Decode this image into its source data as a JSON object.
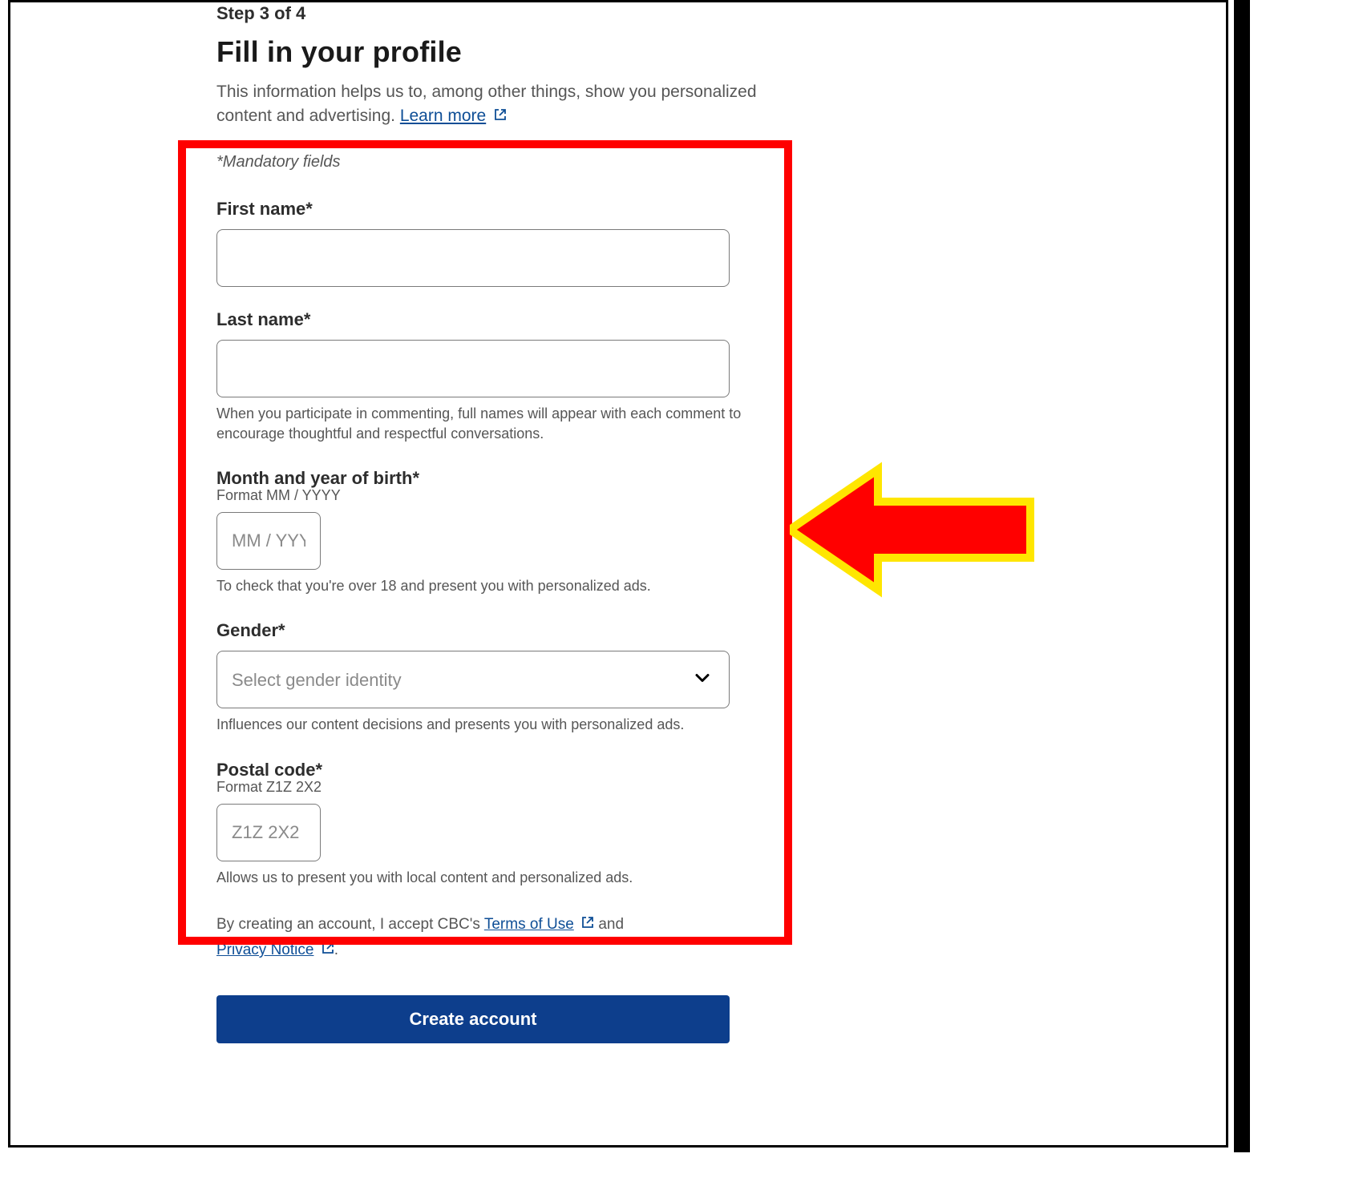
{
  "step": "Step 3 of 4",
  "title": "Fill in your profile",
  "description_before_link": "This information helps us to, among other things, show you personalized content and advertising.  ",
  "learn_more_label": "Learn more",
  "mandatory_note": "*Mandatory fields",
  "fields": {
    "first_name": {
      "label": "First name*"
    },
    "last_name": {
      "label": "Last name*",
      "help": "When you participate in commenting, full names will appear with each comment to encourage thoughtful and respectful conversations."
    },
    "birth": {
      "label": "Month and year of birth*",
      "format": "Format MM / YYYY",
      "placeholder": "MM / YYYY",
      "help": "To check that you're over 18 and present you with personalized ads."
    },
    "gender": {
      "label": "Gender*",
      "placeholder": "Select gender identity",
      "help": "Influences our content decisions and presents you with personalized ads."
    },
    "postal": {
      "label": "Postal code*",
      "format": "Format Z1Z 2X2",
      "placeholder": "Z1Z 2X2",
      "help": "Allows us to present you with local content and personalized ads."
    }
  },
  "legal": {
    "prefix": "By creating an account, I accept CBC's ",
    "terms": "Terms of Use",
    "middle": " and ",
    "privacy": "Privacy Notice",
    "suffix": "."
  },
  "submit_label": "Create account",
  "colors": {
    "accent": "#0d3e8c",
    "link": "#0e4e96",
    "annotation_red": "#ff0000",
    "annotation_yellow": "#ffe600"
  }
}
